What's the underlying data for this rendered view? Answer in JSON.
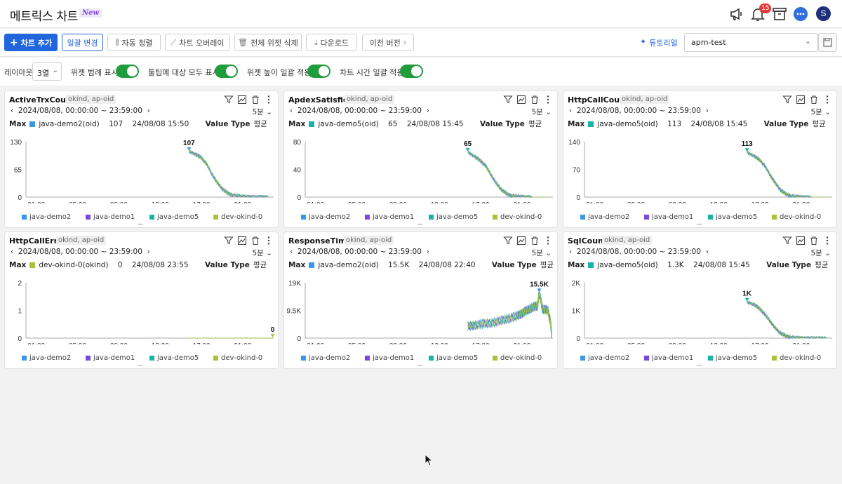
{
  "header": {
    "title": "메트릭스 차트",
    "badge": "New",
    "notification_count": "15",
    "avatar_letter": "S"
  },
  "toolbar": {
    "add_chart": "차트 추가",
    "change_all": "일괄 변경",
    "auto_align": "자동 정렬",
    "overlay": "차트 오버레이",
    "delete_all": "전체 위젯 삭제",
    "download": "다운로드",
    "prev_version": "이전 버전",
    "tutorial": "튜토리얼",
    "project": "apm-test"
  },
  "options": {
    "layout_label": "레이아웃",
    "layout_value": "3열",
    "legend_label": "위젯 범례 표시",
    "tooltip_label": "툴팁에 대상 모두 표시",
    "height_label": "위젯 높이 일괄 적용",
    "time_label": "차트 시간 일괄 적용"
  },
  "colors": {
    "java-demo2": "#3b98e8",
    "java-demo1": "#7b46e0",
    "java-demo5": "#17b3a9",
    "dev-okind-0": "#a8c23a",
    "accent": "#2266dd",
    "toggle_on": "#1f9c3c"
  },
  "legend": [
    "java-demo2",
    "java-demo1",
    "java-demo5",
    "dev-okind-0"
  ],
  "x_ticks": [
    "01:00",
    "05:00",
    "09:00",
    "13:00",
    "17:00",
    "21:00"
  ],
  "widgets": [
    {
      "title": "ActiveTrxCount",
      "tag": "okind, ap-oid",
      "range": "2024/08/08, 00:00:00 ~ 23:59:00",
      "interval": "5분",
      "max_label": "Max",
      "max_series": "java-demo2(oid)",
      "max_color": "java-demo2",
      "max_value": "107",
      "max_time": "24/08/08 15:50",
      "value_type_label": "Value Type",
      "value_type": "평균",
      "y_ticks": [
        "130",
        "65",
        "0"
      ],
      "peak_label": "107"
    },
    {
      "title": "ApdexSatisfied",
      "tag": "okind, ap-oid",
      "range": "2024/08/08, 00:00:00 ~ 23:59:00",
      "interval": "5분",
      "max_label": "Max",
      "max_series": "java-demo5(oid)",
      "max_color": "java-demo5",
      "max_value": "65",
      "max_time": "24/08/08 15:45",
      "value_type_label": "Value Type",
      "value_type": "평균",
      "y_ticks": [
        "80",
        "40",
        "0"
      ],
      "peak_label": "65"
    },
    {
      "title": "HttpCallCount",
      "tag": "okind, ap-oid",
      "range": "2024/08/08, 00:00:00 ~ 23:59:00",
      "interval": "5분",
      "max_label": "Max",
      "max_series": "java-demo5(oid)",
      "max_color": "java-demo5",
      "max_value": "113",
      "max_time": "24/08/08 15:45",
      "value_type_label": "Value Type",
      "value_type": "평균",
      "y_ticks": [
        "140",
        "70",
        "0"
      ],
      "peak_label": "113"
    },
    {
      "title": "HttpCallError",
      "tag": "okind, ap-oid",
      "range": "2024/08/08, 00:00:00 ~ 23:59:00",
      "interval": "5분",
      "max_label": "Max",
      "max_series": "dev-okind-0(okind)",
      "max_color": "dev-okind-0",
      "max_value": "0",
      "max_time": "24/08/08 23:55",
      "value_type_label": "Value Type",
      "value_type": "평균",
      "y_ticks": [
        "2",
        "1",
        "0"
      ],
      "peak_label": "0"
    },
    {
      "title": "ResponseTime",
      "tag": "okind, ap-oid",
      "range": "2024/08/08, 00:00:00 ~ 23:59:00",
      "interval": "5분",
      "max_label": "Max",
      "max_series": "java-demo2(oid)",
      "max_color": "java-demo2",
      "max_value": "15.5K",
      "max_time": "24/08/08 22:40",
      "value_type_label": "Value Type",
      "value_type": "평균",
      "y_ticks": [
        "19K",
        "9.5K",
        "0"
      ],
      "peak_label": "15.5K"
    },
    {
      "title": "SqlCount",
      "tag": "okind, ap-oid",
      "range": "2024/08/08, 00:00:00 ~ 23:59:00",
      "interval": "5분",
      "max_label": "Max",
      "max_series": "java-demo5(oid)",
      "max_color": "java-demo5",
      "max_value": "1.3K",
      "max_time": "24/08/08 15:45",
      "value_type_label": "Value Type",
      "value_type": "평균",
      "y_ticks": [
        "2K",
        "1K",
        "0"
      ],
      "peak_label": "1K"
    }
  ],
  "chart_data": [
    {
      "type": "line",
      "title": "ActiveTrxCount",
      "x_range": [
        "00:00",
        "23:59"
      ],
      "ylim": [
        0,
        130
      ],
      "series_names": [
        "java-demo2",
        "java-demo1",
        "java-demo5",
        "dev-okind-0"
      ],
      "x_hours": [
        15.8,
        16.5,
        17.0,
        17.5,
        18.0,
        18.5,
        19.0,
        19.5,
        20.0,
        21.0,
        22.0,
        23.5
      ],
      "values": [
        107,
        100,
        92,
        78,
        55,
        35,
        20,
        10,
        5,
        2,
        1,
        1
      ],
      "peak": {
        "x_hour": 15.8,
        "value": 107
      }
    },
    {
      "type": "line",
      "title": "ApdexSatisfied",
      "x_range": [
        "00:00",
        "23:59"
      ],
      "ylim": [
        0,
        80
      ],
      "series_names": [
        "java-demo2",
        "java-demo1",
        "java-demo5",
        "dev-okind-0"
      ],
      "x_hours": [
        15.75,
        16.5,
        17.0,
        17.5,
        18.0,
        18.5,
        19.0,
        19.5,
        20.0,
        21.0,
        22.0,
        23.5
      ],
      "values": [
        65,
        58,
        52,
        45,
        32,
        20,
        11,
        5,
        2,
        1,
        0,
        0
      ],
      "peak": {
        "x_hour": 15.75,
        "value": 65
      }
    },
    {
      "type": "line",
      "title": "HttpCallCount",
      "x_range": [
        "00:00",
        "23:59"
      ],
      "ylim": [
        0,
        140
      ],
      "series_names": [
        "java-demo2",
        "java-demo1",
        "java-demo5",
        "dev-okind-0"
      ],
      "x_hours": [
        15.75,
        16.5,
        17.0,
        17.5,
        18.0,
        18.5,
        19.0,
        19.5,
        20.0,
        21.0,
        22.0,
        23.5
      ],
      "values": [
        113,
        103,
        93,
        78,
        55,
        35,
        18,
        8,
        3,
        1,
        0,
        0
      ],
      "peak": {
        "x_hour": 15.75,
        "value": 113
      }
    },
    {
      "type": "line",
      "title": "HttpCallError",
      "x_range": [
        "00:00",
        "23:59"
      ],
      "ylim": [
        0,
        2
      ],
      "series_names": [
        "java-demo2",
        "java-demo1",
        "java-demo5",
        "dev-okind-0"
      ],
      "x_hours": [
        15.75,
        18.0,
        21.0,
        23.9
      ],
      "values": [
        0,
        0,
        0,
        0
      ],
      "peak": {
        "x_hour": 23.9,
        "value": 0
      }
    },
    {
      "type": "line",
      "title": "ResponseTime",
      "x_range": [
        "00:00",
        "23:59"
      ],
      "ylim": [
        0,
        19000
      ],
      "series_names": [
        "java-demo2",
        "java-demo1",
        "java-demo5",
        "dev-okind-0"
      ],
      "x_hours": [
        15.75,
        16.5,
        17.5,
        18.5,
        19.5,
        20.5,
        21.0,
        21.5,
        22.0,
        22.5,
        22.67,
        23.0,
        23.5,
        23.75,
        23.9
      ],
      "values": [
        4000,
        4500,
        5000,
        5500,
        6500,
        7500,
        8500,
        9500,
        10500,
        11000,
        15500,
        10000,
        9500,
        6000,
        500
      ],
      "peak": {
        "x_hour": 22.67,
        "value": 15500
      }
    },
    {
      "type": "line",
      "title": "SqlCount",
      "x_range": [
        "00:00",
        "23:59"
      ],
      "ylim": [
        0,
        2000
      ],
      "series_names": [
        "java-demo2",
        "java-demo1",
        "java-demo5",
        "dev-okind-0"
      ],
      "x_hours": [
        15.75,
        16.5,
        17.0,
        17.5,
        18.0,
        18.5,
        19.0,
        19.5,
        20.0,
        21.0,
        22.0,
        23.5
      ],
      "values": [
        1300,
        1200,
        1050,
        850,
        600,
        350,
        180,
        80,
        30,
        10,
        5,
        5
      ],
      "peak": {
        "x_hour": 15.75,
        "value": 1300
      }
    }
  ]
}
